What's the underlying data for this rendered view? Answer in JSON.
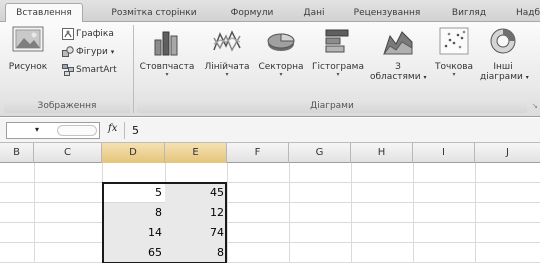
{
  "tabs": [
    {
      "label": "Вставлення",
      "active": true
    },
    {
      "label": "Розмітка сторінки",
      "active": false
    },
    {
      "label": "Формули",
      "active": false
    },
    {
      "label": "Дані",
      "active": false
    },
    {
      "label": "Рецензування",
      "active": false
    },
    {
      "label": "Вигляд",
      "active": false
    },
    {
      "label": "Надб",
      "active": false
    }
  ],
  "ribbon": {
    "images_group": {
      "label": "Зображення",
      "picture_button": "Рисунок",
      "clipart_button": "Графіка",
      "shapes_button": "Фігури",
      "shapes_arrow": "▾",
      "smartart_button": "SmartArt"
    },
    "charts_group": {
      "label": "Діаграми",
      "buttons": [
        {
          "label": "Стовпчаста",
          "arrow": "▾",
          "icon": "column-chart-icon"
        },
        {
          "label": "Лінійчата",
          "arrow": "▾",
          "icon": "line-chart-icon"
        },
        {
          "label": "Секторна",
          "arrow": "▾",
          "icon": "pie-chart-icon"
        },
        {
          "label": "Гістограма",
          "arrow": "▾",
          "icon": "bar-chart-icon"
        },
        {
          "label": "З",
          "label2": "областями",
          "arrow": "▾",
          "icon": "area-chart-icon"
        },
        {
          "label": "Точкова",
          "arrow": "▾",
          "icon": "scatter-chart-icon"
        },
        {
          "label": "Інші",
          "label2": "діаграми",
          "arrow": "▾",
          "icon": "other-charts-icon"
        }
      ]
    },
    "launcher_glyph": "↘"
  },
  "formula_bar": {
    "dropdown_glyph": "▾",
    "fx_label": "fx",
    "value": "5"
  },
  "sheet": {
    "columns": [
      "B",
      "C",
      "D",
      "E",
      "F",
      "G",
      "H",
      "I",
      "J"
    ],
    "selected_columns": [
      "D",
      "E"
    ],
    "rows": [
      {
        "D": "",
        "E": ""
      },
      {
        "D": "5",
        "E": "45"
      },
      {
        "D": "8",
        "E": "12"
      },
      {
        "D": "14",
        "E": "74"
      },
      {
        "D": "65",
        "E": "8"
      }
    ]
  },
  "colors": {
    "selection_border": "#1a1a1a",
    "header_selected": "#e6c47a",
    "ribbon_bg": "#e9e9e9"
  }
}
